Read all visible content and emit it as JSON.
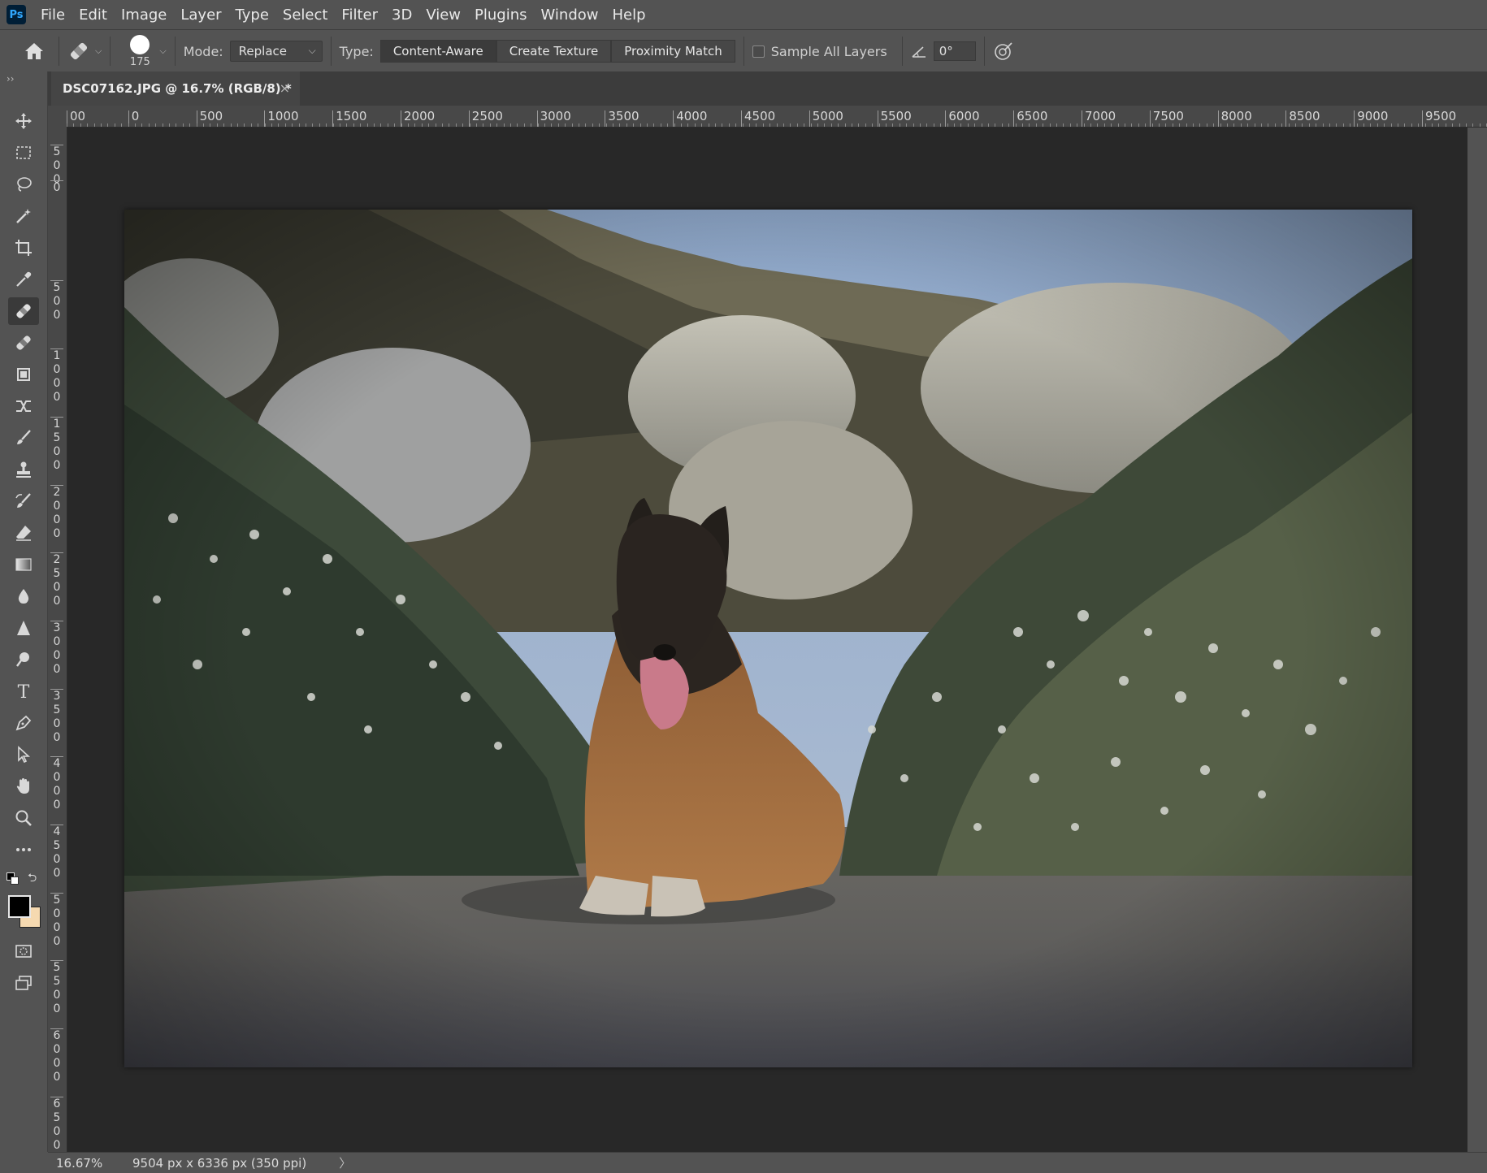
{
  "menu": [
    "File",
    "Edit",
    "Image",
    "Layer",
    "Type",
    "Select",
    "Filter",
    "3D",
    "View",
    "Plugins",
    "Window",
    "Help"
  ],
  "logo": "Ps",
  "options": {
    "brush_size": "175",
    "mode_label": "Mode:",
    "mode_value": "Replace",
    "type_label": "Type:",
    "type_buttons": [
      "Content-Aware",
      "Create Texture",
      "Proximity Match"
    ],
    "sample_all_layers": "Sample All Layers",
    "angle_value": "0°"
  },
  "tab": {
    "title": "DSC07162.JPG @ 16.7% (RGB/8) *",
    "close": "×"
  },
  "ruler_top": [
    "00",
    "0",
    "500",
    "1000",
    "1500",
    "2000",
    "2500",
    "3000",
    "3500",
    "4000",
    "4500",
    "5000",
    "5500",
    "6000",
    "6500",
    "7000",
    "7500",
    "8000",
    "8500",
    "9000",
    "9500"
  ],
  "ruler_left": [
    "500",
    "0",
    "500",
    "1000",
    "1500",
    "2000",
    "2500",
    "3000",
    "3500",
    "4000",
    "4500",
    "5000",
    "5500",
    "6000",
    "6500"
  ],
  "status": {
    "zoom": "16.67%",
    "doc_info": "9504 px x 6336 px (350 ppi)",
    "arrow": "〉"
  },
  "colors": {
    "foreground": "#000000",
    "background": "#f5d9b0"
  },
  "tools": [
    "move-icon",
    "marquee-icon",
    "lasso-icon",
    "magic-wand-icon",
    "crop-icon",
    "eyedropper-icon",
    "spot-healing-icon",
    "patch-icon",
    "content-aware-move-icon",
    "recompose-icon",
    "brush-icon",
    "clone-stamp-icon",
    "history-brush-icon",
    "eraser-icon",
    "gradient-icon",
    "blur-icon",
    "sharpen-icon",
    "dodge-icon",
    "type-icon",
    "pen-icon",
    "path-select-icon",
    "hand-icon",
    "zoom-icon",
    "more-tools-icon"
  ]
}
